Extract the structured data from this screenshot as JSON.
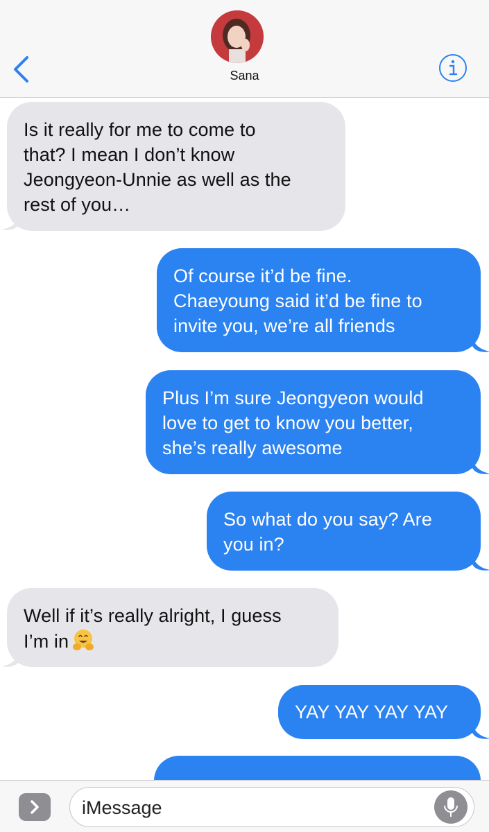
{
  "header": {
    "contact_name": "Sana",
    "back_icon": "chevron-left-icon",
    "info_icon": "info-icon",
    "accent_color": "#2b82f1"
  },
  "messages": [
    {
      "direction": "incoming",
      "lines": [
        "Is it really for me to come to",
        "that? I mean I don’t know",
        "Jeongyeon-Unnie as well as the",
        "rest of you…"
      ]
    },
    {
      "direction": "outgoing",
      "lines": [
        "Of course it’d be fine.",
        "Chaeyoung said it’d be fine to",
        "invite you, we’re all friends"
      ]
    },
    {
      "direction": "outgoing",
      "lines": [
        "Plus I’m sure Jeongyeon would",
        "love to get to know you better,",
        "she’s really awesome"
      ]
    },
    {
      "direction": "outgoing",
      "lines": [
        "So what do you say? Are",
        "you in?"
      ]
    },
    {
      "direction": "incoming",
      "lines": [
        "Well if it’s really alright, I guess",
        "I’m in"
      ],
      "emoji": "hugging-face-emoji"
    },
    {
      "direction": "outgoing",
      "lines": [
        "YAY YAY YAY YAY"
      ]
    }
  ],
  "input_bar": {
    "placeholder": "iMessage",
    "expand_icon": "chevron-right-icon",
    "mic_icon": "microphone-icon"
  }
}
